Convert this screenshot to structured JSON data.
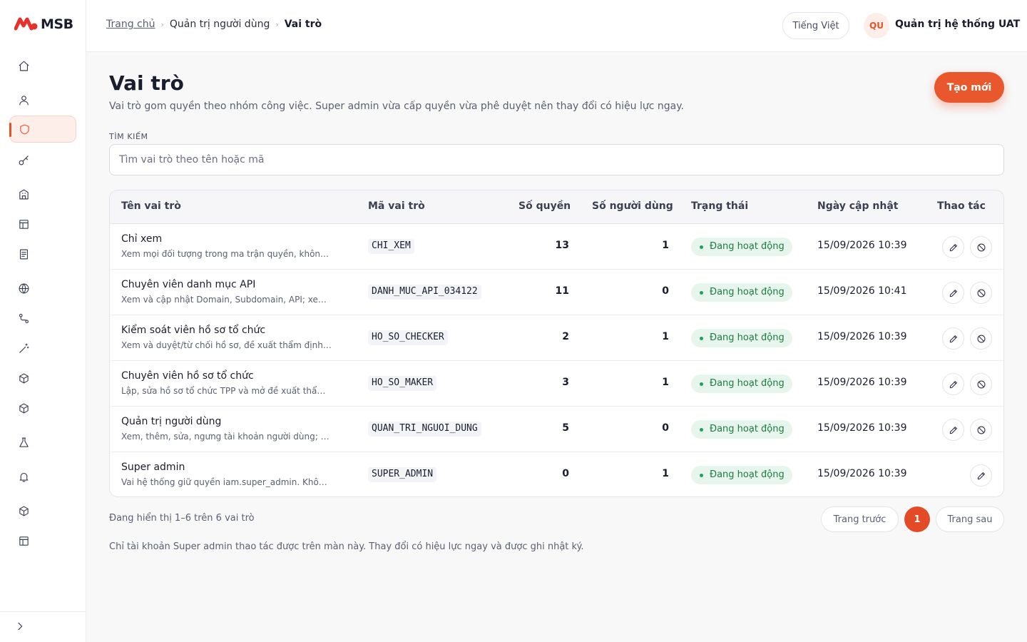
{
  "brand": {
    "name": "MSB",
    "accent": "#e5532a"
  },
  "sidebar": {
    "items": [
      {
        "icon": "home-icon"
      },
      {
        "icon": "user-icon"
      },
      {
        "icon": "shield-icon",
        "active": true
      },
      {
        "icon": "key-icon"
      },
      {
        "icon": "building-icon"
      },
      {
        "icon": "layout-icon"
      },
      {
        "icon": "document-icon"
      },
      {
        "icon": "globe-icon"
      },
      {
        "icon": "route-icon"
      },
      {
        "icon": "magic-wand-icon"
      },
      {
        "icon": "cube-icon"
      },
      {
        "icon": "cube-icon"
      },
      {
        "icon": "flask-icon"
      },
      {
        "icon": "bell-icon"
      },
      {
        "icon": "cube-icon"
      },
      {
        "icon": "layout-icon"
      }
    ],
    "collapse_icon": "chevron-right-icon"
  },
  "header": {
    "breadcrumb": {
      "home": "Trang chủ",
      "section": "Quản trị người dùng",
      "current": "Vai trò"
    },
    "language": "Tiếng Việt",
    "user": {
      "initials": "QU",
      "name": "Quản trị hệ thống UAT"
    }
  },
  "page": {
    "title": "Vai trò",
    "description": "Vai trò gom quyền theo nhóm công việc. Super admin vừa cấp quyền vừa phê duyệt nên thay đổi có hiệu lực ngay.",
    "create_label": "Tạo mới"
  },
  "search": {
    "label": "TÌM KIẾM",
    "placeholder": "Tìm vai trò theo tên hoặc mã",
    "value": ""
  },
  "table": {
    "columns": {
      "name": "Tên vai trò",
      "code": "Mã vai trò",
      "permissions": "Số quyền",
      "users": "Số người dùng",
      "status": "Trạng thái",
      "updated": "Ngày cập nhật",
      "actions": "Thao tác"
    },
    "rows": [
      {
        "name": "Chỉ xem",
        "desc": "Xem mọi đối tượng trong ma trận quyền, không s...",
        "code": "CHI_XEM",
        "permissions": "13",
        "users": "1",
        "status": "Đang hoạt động",
        "updated": "15/09/2026 10:39"
      },
      {
        "name": "Chuyên viên danh mục API",
        "desc": "Xem và cập nhật Domain, Subdomain, API; xem ...",
        "code": "DANH_MUC_API_034122",
        "permissions": "11",
        "users": "0",
        "status": "Đang hoạt động",
        "updated": "15/09/2026 10:41"
      },
      {
        "name": "Kiểm soát viên hồ sơ tổ chức",
        "desc": "Xem và duyệt/từ chối hồ sơ, đề xuất thẩm định c...",
        "code": "HO_SO_CHECKER",
        "permissions": "2",
        "users": "1",
        "status": "Đang hoạt động",
        "updated": "15/09/2026 10:39"
      },
      {
        "name": "Chuyên viên hồ sơ tổ chức",
        "desc": "Lập, sửa hồ sơ tổ chức TPP và mở đề xuất thẩm ...",
        "code": "HO_SO_MAKER",
        "permissions": "3",
        "users": "1",
        "status": "Đang hoạt động",
        "updated": "15/09/2026 10:39"
      },
      {
        "name": "Quản trị người dùng",
        "desc": "Xem, thêm, sửa, ngưng tài khoản người dùng; xe...",
        "code": "QUAN_TRI_NGUOI_DUNG",
        "permissions": "5",
        "users": "0",
        "status": "Đang hoạt động",
        "updated": "15/09/2026 10:39"
      },
      {
        "name": "Super admin",
        "desc": "Vai hệ thống giữ quyền iam.super_admin. Không...",
        "code": "SUPER_ADMIN",
        "permissions": "0",
        "users": "1",
        "status": "Đang hoạt động",
        "updated": "15/09/2026 10:39"
      }
    ]
  },
  "pagination": {
    "showing": "Đang hiển thị 1–6 trên 6 vai trò",
    "prev": "Trang trước",
    "current": "1",
    "next": "Trang sau"
  },
  "footer_note": "Chỉ tài khoản Super admin thao tác được trên màn này. Thay đổi có hiệu lực ngay và được ghi nhật ký."
}
